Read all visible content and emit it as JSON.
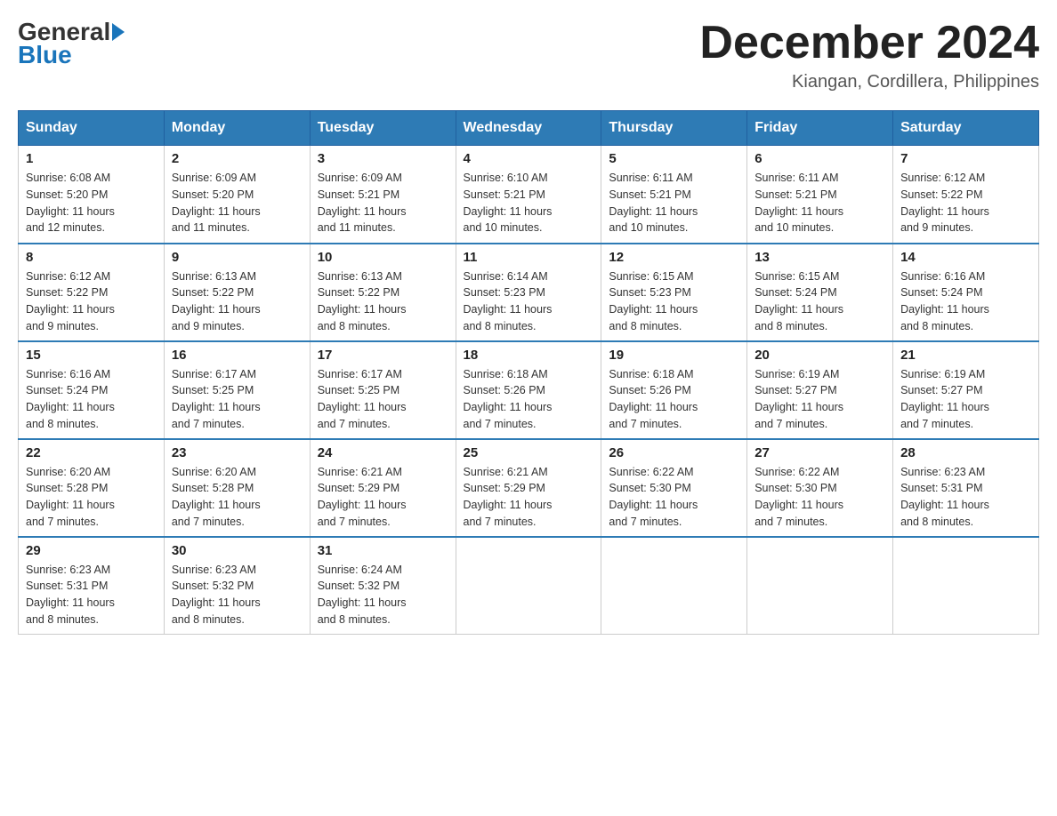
{
  "header": {
    "logo_general": "General",
    "logo_blue": "Blue",
    "month_title": "December 2024",
    "location": "Kiangan, Cordillera, Philippines"
  },
  "weekdays": [
    "Sunday",
    "Monday",
    "Tuesday",
    "Wednesday",
    "Thursday",
    "Friday",
    "Saturday"
  ],
  "weeks": [
    [
      {
        "day": "1",
        "sunrise": "6:08 AM",
        "sunset": "5:20 PM",
        "daylight": "11 hours and 12 minutes."
      },
      {
        "day": "2",
        "sunrise": "6:09 AM",
        "sunset": "5:20 PM",
        "daylight": "11 hours and 11 minutes."
      },
      {
        "day": "3",
        "sunrise": "6:09 AM",
        "sunset": "5:21 PM",
        "daylight": "11 hours and 11 minutes."
      },
      {
        "day": "4",
        "sunrise": "6:10 AM",
        "sunset": "5:21 PM",
        "daylight": "11 hours and 10 minutes."
      },
      {
        "day": "5",
        "sunrise": "6:11 AM",
        "sunset": "5:21 PM",
        "daylight": "11 hours and 10 minutes."
      },
      {
        "day": "6",
        "sunrise": "6:11 AM",
        "sunset": "5:21 PM",
        "daylight": "11 hours and 10 minutes."
      },
      {
        "day": "7",
        "sunrise": "6:12 AM",
        "sunset": "5:22 PM",
        "daylight": "11 hours and 9 minutes."
      }
    ],
    [
      {
        "day": "8",
        "sunrise": "6:12 AM",
        "sunset": "5:22 PM",
        "daylight": "11 hours and 9 minutes."
      },
      {
        "day": "9",
        "sunrise": "6:13 AM",
        "sunset": "5:22 PM",
        "daylight": "11 hours and 9 minutes."
      },
      {
        "day": "10",
        "sunrise": "6:13 AM",
        "sunset": "5:22 PM",
        "daylight": "11 hours and 8 minutes."
      },
      {
        "day": "11",
        "sunrise": "6:14 AM",
        "sunset": "5:23 PM",
        "daylight": "11 hours and 8 minutes."
      },
      {
        "day": "12",
        "sunrise": "6:15 AM",
        "sunset": "5:23 PM",
        "daylight": "11 hours and 8 minutes."
      },
      {
        "day": "13",
        "sunrise": "6:15 AM",
        "sunset": "5:24 PM",
        "daylight": "11 hours and 8 minutes."
      },
      {
        "day": "14",
        "sunrise": "6:16 AM",
        "sunset": "5:24 PM",
        "daylight": "11 hours and 8 minutes."
      }
    ],
    [
      {
        "day": "15",
        "sunrise": "6:16 AM",
        "sunset": "5:24 PM",
        "daylight": "11 hours and 8 minutes."
      },
      {
        "day": "16",
        "sunrise": "6:17 AM",
        "sunset": "5:25 PM",
        "daylight": "11 hours and 7 minutes."
      },
      {
        "day": "17",
        "sunrise": "6:17 AM",
        "sunset": "5:25 PM",
        "daylight": "11 hours and 7 minutes."
      },
      {
        "day": "18",
        "sunrise": "6:18 AM",
        "sunset": "5:26 PM",
        "daylight": "11 hours and 7 minutes."
      },
      {
        "day": "19",
        "sunrise": "6:18 AM",
        "sunset": "5:26 PM",
        "daylight": "11 hours and 7 minutes."
      },
      {
        "day": "20",
        "sunrise": "6:19 AM",
        "sunset": "5:27 PM",
        "daylight": "11 hours and 7 minutes."
      },
      {
        "day": "21",
        "sunrise": "6:19 AM",
        "sunset": "5:27 PM",
        "daylight": "11 hours and 7 minutes."
      }
    ],
    [
      {
        "day": "22",
        "sunrise": "6:20 AM",
        "sunset": "5:28 PM",
        "daylight": "11 hours and 7 minutes."
      },
      {
        "day": "23",
        "sunrise": "6:20 AM",
        "sunset": "5:28 PM",
        "daylight": "11 hours and 7 minutes."
      },
      {
        "day": "24",
        "sunrise": "6:21 AM",
        "sunset": "5:29 PM",
        "daylight": "11 hours and 7 minutes."
      },
      {
        "day": "25",
        "sunrise": "6:21 AM",
        "sunset": "5:29 PM",
        "daylight": "11 hours and 7 minutes."
      },
      {
        "day": "26",
        "sunrise": "6:22 AM",
        "sunset": "5:30 PM",
        "daylight": "11 hours and 7 minutes."
      },
      {
        "day": "27",
        "sunrise": "6:22 AM",
        "sunset": "5:30 PM",
        "daylight": "11 hours and 7 minutes."
      },
      {
        "day": "28",
        "sunrise": "6:23 AM",
        "sunset": "5:31 PM",
        "daylight": "11 hours and 8 minutes."
      }
    ],
    [
      {
        "day": "29",
        "sunrise": "6:23 AM",
        "sunset": "5:31 PM",
        "daylight": "11 hours and 8 minutes."
      },
      {
        "day": "30",
        "sunrise": "6:23 AM",
        "sunset": "5:32 PM",
        "daylight": "11 hours and 8 minutes."
      },
      {
        "day": "31",
        "sunrise": "6:24 AM",
        "sunset": "5:32 PM",
        "daylight": "11 hours and 8 minutes."
      },
      null,
      null,
      null,
      null
    ]
  ],
  "labels": {
    "sunrise": "Sunrise:",
    "sunset": "Sunset:",
    "daylight": "Daylight:"
  }
}
